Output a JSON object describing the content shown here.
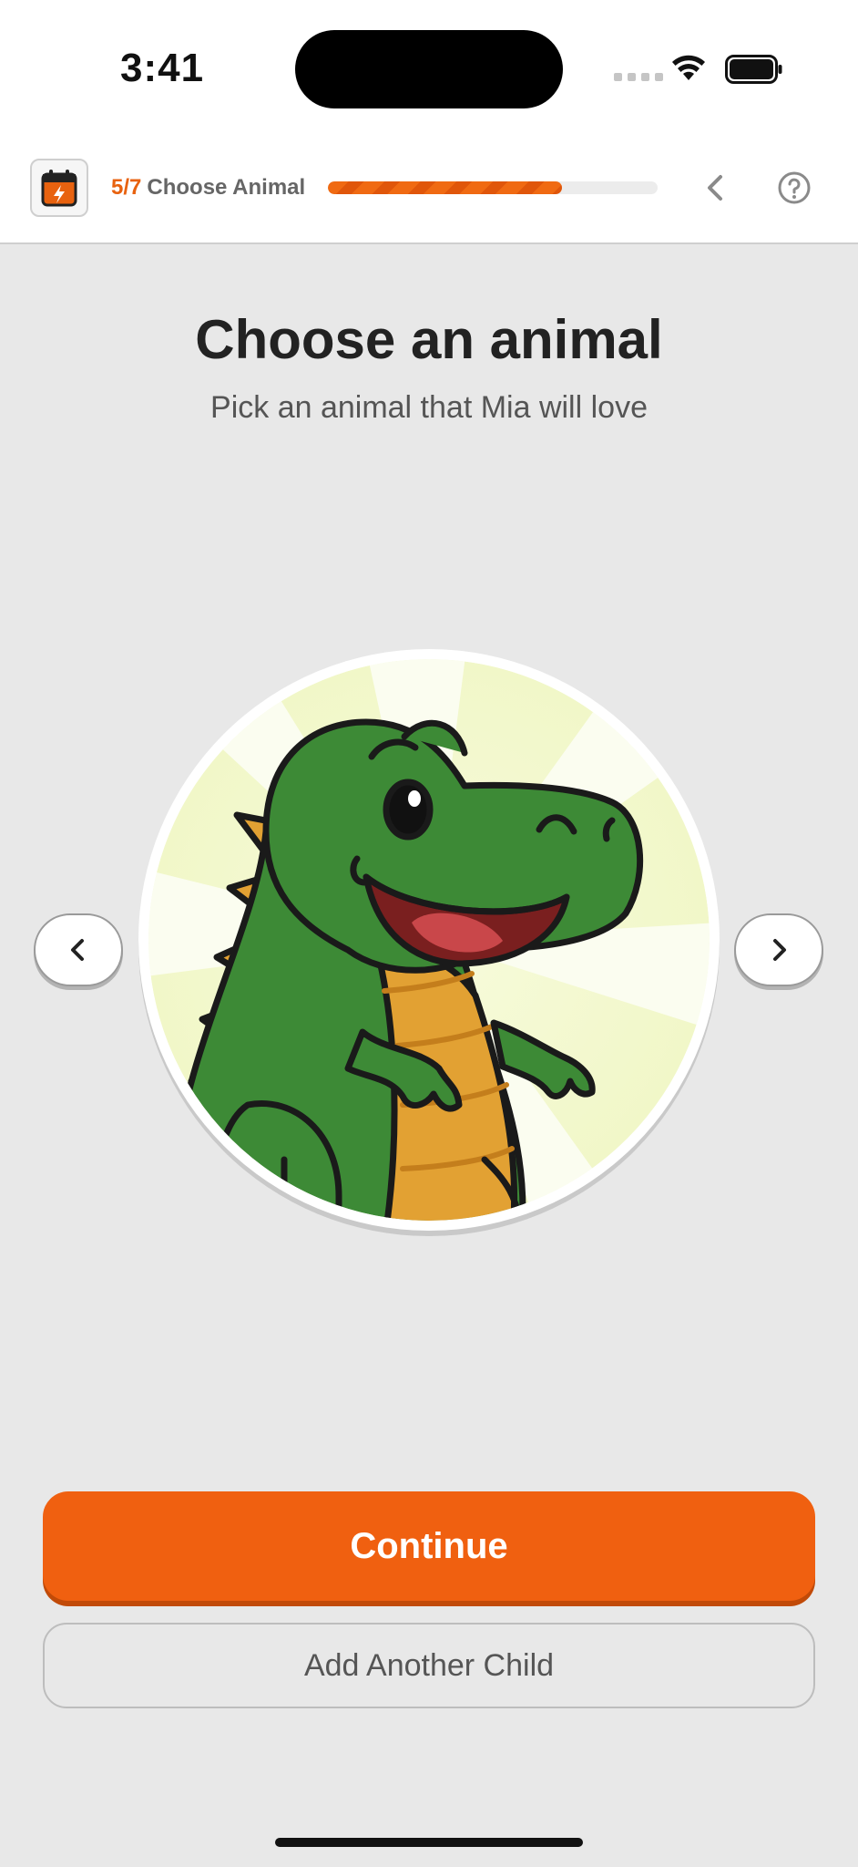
{
  "status_bar": {
    "time": "3:41"
  },
  "header": {
    "step_count": "5/7",
    "step_label": "Choose Animal",
    "progress_fraction": 0.71,
    "icons": {
      "app": "calendar-bolt-icon",
      "back": "chevron-left-icon",
      "help": "question-circle-icon"
    }
  },
  "main": {
    "title": "Choose an animal",
    "subtitle": "Pick an animal that Mia will love",
    "selected_animal_icon": "dinosaur-illustration"
  },
  "nav": {
    "prev_icon": "chevron-left-icon",
    "next_icon": "chevron-right-icon"
  },
  "actions": {
    "continue_label": "Continue",
    "add_child_label": "Add Another Child"
  },
  "colors": {
    "accent": "#f06010",
    "background": "#e8e8e8",
    "dino_green": "#3d8a36",
    "dino_belly": "#e2a133"
  }
}
